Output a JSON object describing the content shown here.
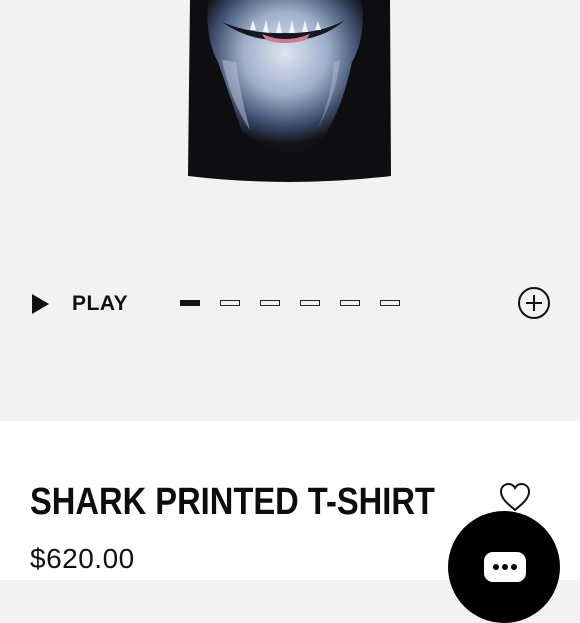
{
  "gallery": {
    "play_label": "PLAY",
    "slide_count": 6,
    "active_slide": 1
  },
  "product": {
    "title": "SHARK PRINTED T-SHIRT",
    "price": "$620.00"
  },
  "icons": {
    "play": "play-icon",
    "zoom": "plus-circle-icon",
    "wishlist": "heart-icon",
    "chat": "chat-bubble-icon"
  },
  "colors": {
    "background": "#f2f2f2",
    "details_background": "#ffffff",
    "text": "#111111",
    "chat_button": "#000000"
  }
}
